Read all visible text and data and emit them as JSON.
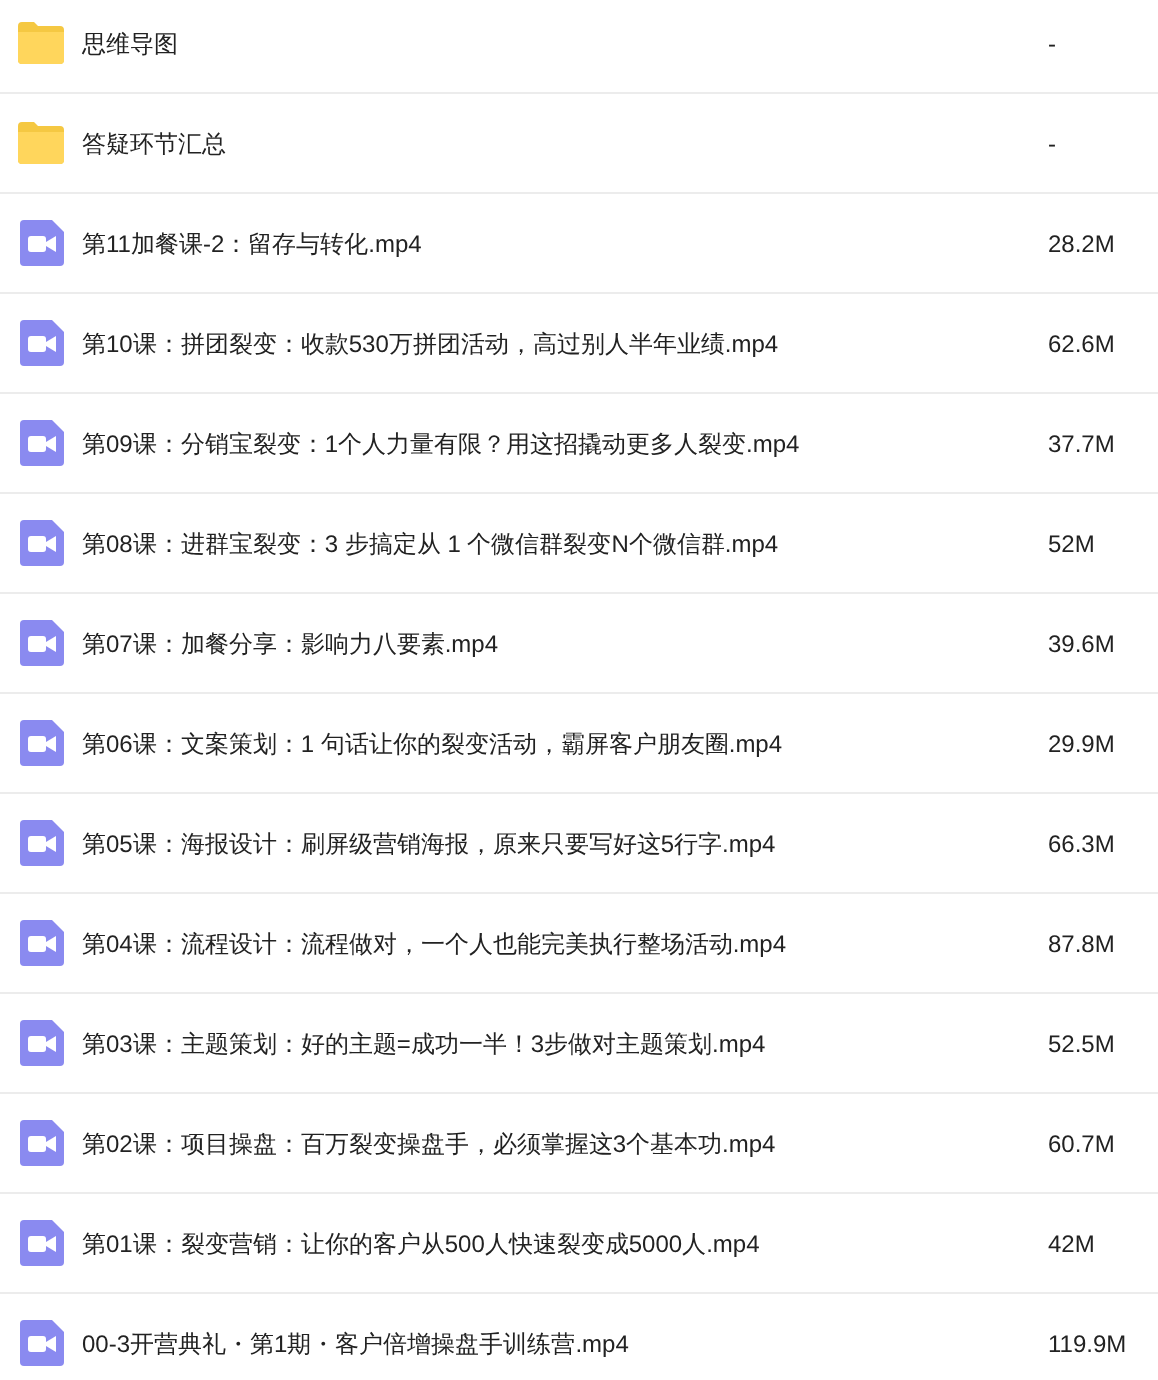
{
  "files": [
    {
      "kind": "folder",
      "name": "思维导图",
      "size": "-"
    },
    {
      "kind": "folder",
      "name": "答疑环节汇总",
      "size": "-"
    },
    {
      "kind": "video",
      "name": "第11加餐课-2：留存与转化.mp4",
      "size": "28.2M"
    },
    {
      "kind": "video",
      "name": "第10课：拼团裂变：收款530万拼团活动，高过别人半年业绩.mp4",
      "size": "62.6M"
    },
    {
      "kind": "video",
      "name": "第09课：分销宝裂变：1个人力量有限？用这招撬动更多人裂变.mp4",
      "size": "37.7M"
    },
    {
      "kind": "video",
      "name": "第08课：进群宝裂变：3 步搞定从 1 个微信群裂变N个微信群.mp4",
      "size": "52M"
    },
    {
      "kind": "video",
      "name": "第07课：加餐分享：影响力八要素.mp4",
      "size": "39.6M"
    },
    {
      "kind": "video",
      "name": "第06课：文案策划：1 句话让你的裂变活动，霸屏客户朋友圈.mp4",
      "size": "29.9M"
    },
    {
      "kind": "video",
      "name": "第05课：海报设计：刷屏级营销海报，原来只要写好这5行字.mp4",
      "size": "66.3M"
    },
    {
      "kind": "video",
      "name": "第04课：流程设计：流程做对，一个人也能完美执行整场活动.mp4",
      "size": "87.8M"
    },
    {
      "kind": "video",
      "name": "第03课：主题策划：好的主题=成功一半！3步做对主题策划.mp4",
      "size": "52.5M"
    },
    {
      "kind": "video",
      "name": "第02课：项目操盘：百万裂变操盘手，必须掌握这3个基本功.mp4",
      "size": "60.7M"
    },
    {
      "kind": "video",
      "name": "第01课：裂变营销：让你的客户从500人快速裂变成5000人.mp4",
      "size": "42M"
    },
    {
      "kind": "video",
      "name": "00-3开营典礼・第1期・客户倍增操盘手训练营.mp4",
      "size": "119.9M"
    }
  ]
}
